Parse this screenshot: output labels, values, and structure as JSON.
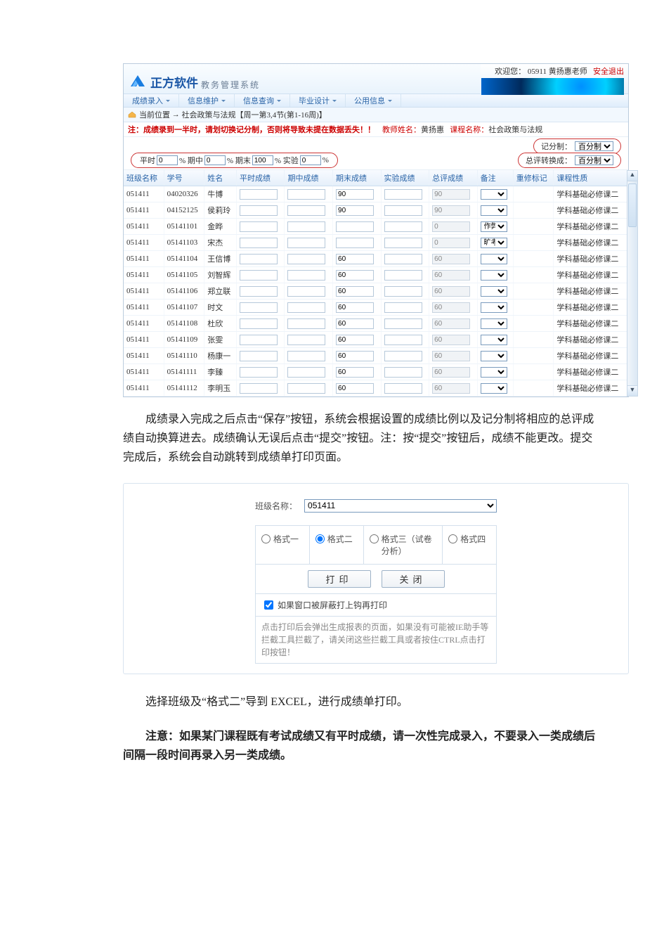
{
  "header": {
    "brand_title": "正方软件",
    "brand_sub": "教务管理系统",
    "welcome_prefix": "欢迎您：",
    "welcome_user": "05911 黄扬惠老师",
    "logout_label": "安全退出"
  },
  "menu": {
    "items": [
      {
        "label": "成绩录入"
      },
      {
        "label": "信息维护"
      },
      {
        "label": "信息查询"
      },
      {
        "label": "毕业设计"
      },
      {
        "label": "公用信息"
      }
    ]
  },
  "breadcrumb": {
    "prefix": "当前位置",
    "arrow": "→",
    "text": "社会政策与法规【周一第3,4节(第1-16周)】"
  },
  "warning": {
    "text": "注：成绩录到一半时，请划切换记分制，否则将导致未提在数据丢失！！",
    "teacher_label": "教师姓名：",
    "teacher_value": "黄扬惠",
    "course_label": "课程名称：",
    "course_value": "社会政策与法规"
  },
  "settings": {
    "score_sys_label": "记分制：",
    "score_sys_value": "百分制",
    "total_conv_label": "总评转换成：",
    "total_conv_value": "百分制",
    "pct": {
      "ps_label": "平时",
      "ps_val": "0",
      "qz_label": "% 期中",
      "qz_val": "0",
      "qm_label": "% 期末",
      "qm_val": "100",
      "sy_label": "% 实验",
      "sy_val": "0",
      "tail": "%"
    }
  },
  "grid": {
    "headers": {
      "class": "班级名称",
      "sid": "学号",
      "name": "姓名",
      "ps": "平时成绩",
      "qz": "期中成绩",
      "qm": "期末成绩",
      "sy": "实验成绩",
      "zp": "总评成绩",
      "bz": "备注",
      "cx": "重修标记",
      "kx": "课程性质"
    },
    "rows": [
      {
        "class": "051411",
        "sid": "04020326",
        "name": "牛博",
        "qm": "90",
        "zp": "90",
        "bz": "",
        "kx": "学科基础必修课二"
      },
      {
        "class": "051411",
        "sid": "04152125",
        "name": "侯莉玲",
        "qm": "90",
        "zp": "90",
        "bz": "",
        "kx": "学科基础必修课二"
      },
      {
        "class": "051411",
        "sid": "05141101",
        "name": "金晔",
        "qm": "",
        "zp": "0",
        "bz": "作弊",
        "kx": "学科基础必修课二"
      },
      {
        "class": "051411",
        "sid": "05141103",
        "name": "宋杰",
        "qm": "",
        "zp": "0",
        "bz": "旷考",
        "kx": "学科基础必修课二"
      },
      {
        "class": "051411",
        "sid": "05141104",
        "name": "王信博",
        "qm": "60",
        "zp": "60",
        "bz": "",
        "kx": "学科基础必修课二"
      },
      {
        "class": "051411",
        "sid": "05141105",
        "name": "刘智辉",
        "qm": "60",
        "zp": "60",
        "bz": "",
        "kx": "学科基础必修课二"
      },
      {
        "class": "051411",
        "sid": "05141106",
        "name": "郑立联",
        "qm": "60",
        "zp": "60",
        "bz": "",
        "kx": "学科基础必修课二"
      },
      {
        "class": "051411",
        "sid": "05141107",
        "name": "时文",
        "qm": "60",
        "zp": "60",
        "bz": "",
        "kx": "学科基础必修课二"
      },
      {
        "class": "051411",
        "sid": "05141108",
        "name": "杜欣",
        "qm": "60",
        "zp": "60",
        "bz": "",
        "kx": "学科基础必修课二"
      },
      {
        "class": "051411",
        "sid": "05141109",
        "name": "张雯",
        "qm": "60",
        "zp": "60",
        "bz": "",
        "kx": "学科基础必修课二"
      },
      {
        "class": "051411",
        "sid": "05141110",
        "name": "杨康一",
        "qm": "60",
        "zp": "60",
        "bz": "",
        "kx": "学科基础必修课二"
      },
      {
        "class": "051411",
        "sid": "05141111",
        "name": "李臻",
        "qm": "60",
        "zp": "60",
        "bz": "",
        "kx": "学科基础必修课二"
      },
      {
        "class": "051411",
        "sid": "05141112",
        "name": "李明玉",
        "qm": "60",
        "zp": "60",
        "bz": "",
        "kx": "学科基础必修课二"
      }
    ]
  },
  "paragraphs": {
    "p1": "成绩录入完成之后点击“保存”按钮，系统会根据设置的成绩比例以及记分制将相应的总评成绩自动换算进去。成绩确认无误后点击“提交”按钮。注：按“提交”按钮后，成绩不能更改。提交完成后，系统会自动跳转到成绩单打印页面。",
    "p2": "选择班级及“格式二”导到 EXCEL，进行成绩单打印。",
    "p3": "注意：如果某门课程既有考试成绩又有平时成绩，请一次性完成录入，不要录入一类成绩后间隔一段时间再录入另一类成绩。"
  },
  "dialog": {
    "class_label": "班级名称：",
    "class_value": "051411",
    "opts": {
      "o1": "格式一",
      "o2": "格式二",
      "o3": "格式三（试卷分析）",
      "o4": "格式四"
    },
    "btn_print": "打印",
    "btn_close": "关闭",
    "chk_label": "如果窗口被屏蔽打上钩再打印",
    "note": "点击打印后会弹出生成报表的页面，如果没有可能被IE助手等拦截工具拦截了，请关闭这些拦截工具或者按住CTRL点击打印按钮！"
  }
}
